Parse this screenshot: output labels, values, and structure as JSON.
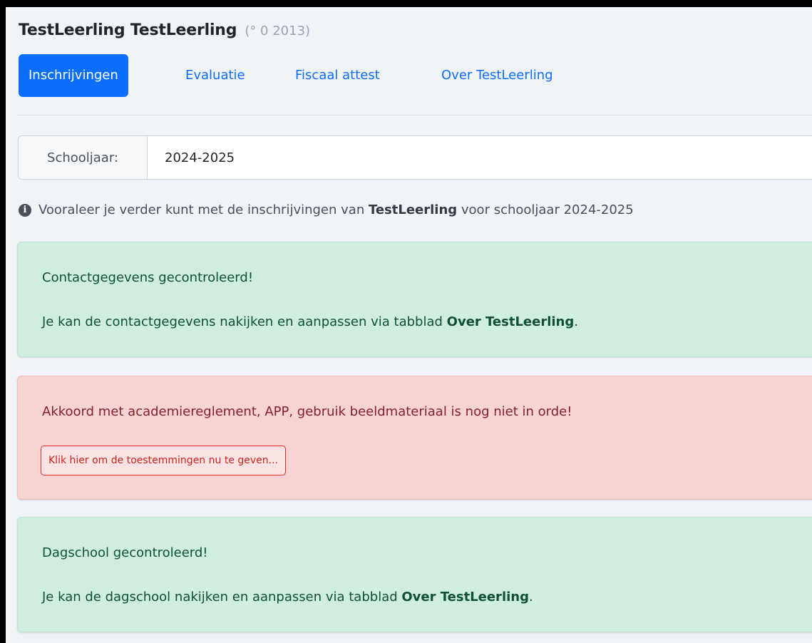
{
  "header": {
    "student_name": "TestLeerling TestLeerling",
    "birth_info": "(° 0 2013)"
  },
  "tabs": [
    {
      "label": "Inschrijvingen",
      "active": true
    },
    {
      "label": "Evaluatie",
      "active": false
    },
    {
      "label": "Fiscaal attest",
      "active": false
    },
    {
      "label": "Over TestLeerling",
      "active": false
    }
  ],
  "schoolyear": {
    "label": "Schooljaar:",
    "value": "2024-2025"
  },
  "info": {
    "icon": "info-circle-icon",
    "text_before": "Vooraleer je verder kunt met de inschrijvingen van ",
    "student": "TestLeerling",
    "text_after": " voor schooljaar 2024-2025"
  },
  "alerts": {
    "contact": {
      "title": "Contactgegevens gecontroleerd!",
      "text": "Je kan de contactgegevens nakijken en aanpassen via tabblad ",
      "link": "Over TestLeerling",
      "suffix": "."
    },
    "permissions": {
      "title": "Akkoord met academiereglement, APP, gebruik beeldmateriaal is nog niet in orde!",
      "button": "Klik hier om de toestemmingen nu te geven..."
    },
    "dayschool": {
      "title": "Dagschool gecontroleerd!",
      "text": "Je kan de dagschool nakijken en aanpassen via tabblad ",
      "link": "Over TestLeerling",
      "suffix": "."
    }
  },
  "colors": {
    "primary": "#0d6efd",
    "success_bg": "#cfeee0",
    "success_text": "#0f5132",
    "danger_bg": "#f8d3d3",
    "danger_text": "#842029"
  }
}
